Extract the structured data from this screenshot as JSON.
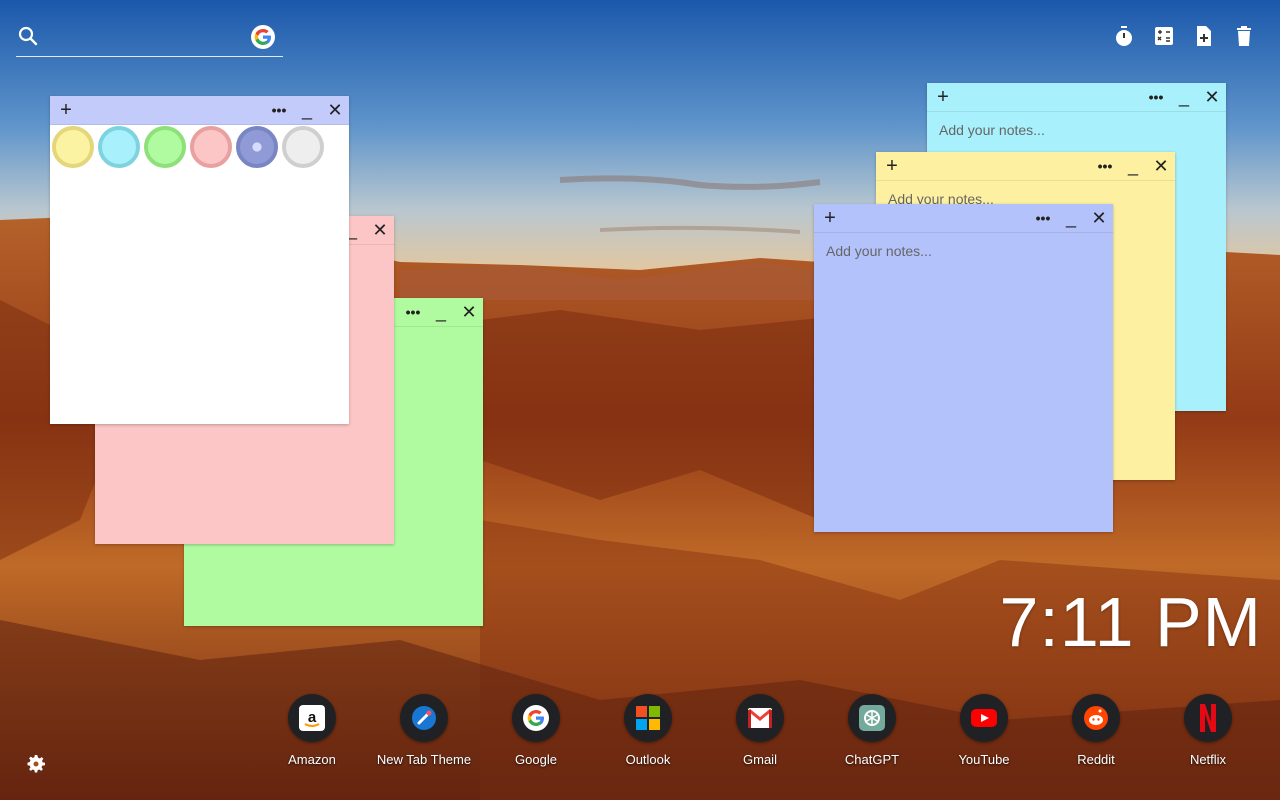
{
  "search": {
    "placeholder": "",
    "engine_icon": "google-icon"
  },
  "toolbar": {
    "icons": [
      "timer-icon",
      "calculator-icon",
      "add-note-icon",
      "trash-icon"
    ]
  },
  "notes": [
    {
      "color": "#a8f0fb",
      "header": "#a8f0fb",
      "placeholder": "Add your notes..."
    },
    {
      "color": "#fdf0a0",
      "header": "#fdf0a0",
      "placeholder": "Add your notes..."
    },
    {
      "color": "#b3c2fb",
      "header": "#b3c2fb",
      "placeholder": "Add your notes..."
    },
    {
      "color": "#b0fba0",
      "header": "#b0fba0",
      "placeholder": ""
    },
    {
      "color": "#fcc6c6",
      "header": "#fcc6c6",
      "placeholder": ""
    },
    {
      "color": "#ffffff",
      "header": "#c3cbfb",
      "placeholder": ""
    }
  ],
  "note_buttons": {
    "add": "+",
    "more": "•••",
    "minimize": "_",
    "close": "✕"
  },
  "color_picker": {
    "swatches": [
      {
        "fill": "#fbf3a2",
        "ring": "#e4d67a"
      },
      {
        "fill": "#a8f0fb",
        "ring": "#7fd3e0"
      },
      {
        "fill": "#b0fba0",
        "ring": "#8ee07b"
      },
      {
        "fill": "#fcc6c6",
        "ring": "#e8a0a0"
      },
      {
        "fill": "#8f9ad6",
        "ring": "#7a85c4"
      },
      {
        "fill": "#eeeeee",
        "ring": "#cfcfcf"
      }
    ]
  },
  "clock": {
    "time": "7:11 PM"
  },
  "dock": {
    "items": [
      {
        "label": "Amazon",
        "icon": "amazon-icon"
      },
      {
        "label": "New Tab Theme",
        "icon": "new-tab-theme-icon"
      },
      {
        "label": "Google",
        "icon": "google-icon"
      },
      {
        "label": "Outlook",
        "icon": "outlook-icon"
      },
      {
        "label": "Gmail",
        "icon": "gmail-icon"
      },
      {
        "label": "ChatGPT",
        "icon": "chatgpt-icon"
      },
      {
        "label": "YouTube",
        "icon": "youtube-icon"
      },
      {
        "label": "Reddit",
        "icon": "reddit-icon"
      },
      {
        "label": "Netflix",
        "icon": "netflix-icon"
      }
    ]
  },
  "settings": {
    "icon": "gear-icon"
  }
}
